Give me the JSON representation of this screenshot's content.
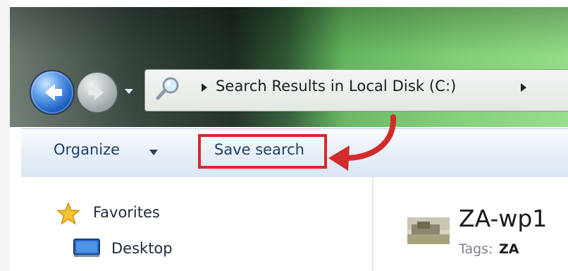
{
  "address_bar": {
    "breadcrumb": "Search Results in Local Disk (C:)"
  },
  "toolbar": {
    "organize_label": "Organize",
    "save_search_label": "Save search"
  },
  "nav_pane": {
    "items": [
      {
        "label": "Favorites",
        "icon": "star-icon"
      },
      {
        "label": "Desktop",
        "icon": "desktop-icon"
      }
    ]
  },
  "results": {
    "items": [
      {
        "name": "ZA-wp1",
        "tags_label": "Tags:",
        "tags_value": "ZA",
        "icon": "image-thumbnail-icon"
      }
    ]
  },
  "colors": {
    "highlight": "#d32a2a",
    "toolbar_text": "#1f3f6a",
    "back_button": "#1d5fbf"
  }
}
